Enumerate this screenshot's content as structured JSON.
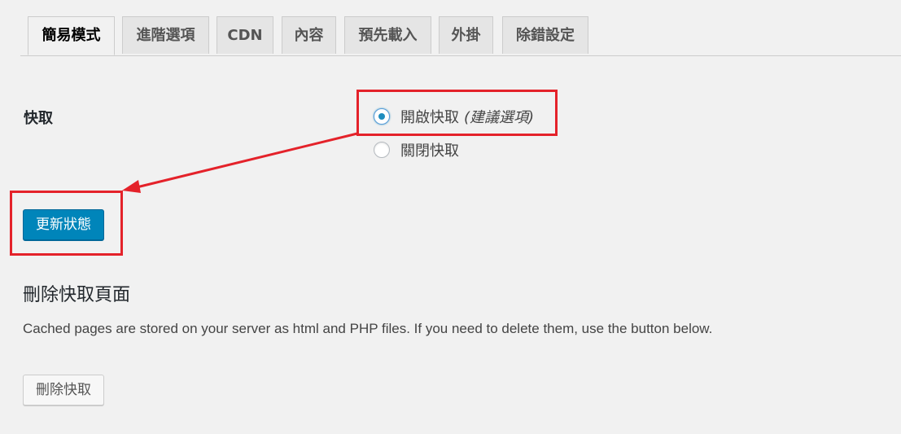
{
  "tabs": [
    {
      "label": "簡易模式",
      "active": true
    },
    {
      "label": "進階選項",
      "active": false
    },
    {
      "label": "CDN",
      "active": false
    },
    {
      "label": "內容",
      "active": false
    },
    {
      "label": "預先載入",
      "active": false
    },
    {
      "label": "外掛",
      "active": false
    },
    {
      "label": "除錯設定",
      "active": false
    }
  ],
  "caching": {
    "label": "快取",
    "options": [
      {
        "label": "開啟快取",
        "hint": "(建議選項)",
        "checked": true
      },
      {
        "label": "關閉快取",
        "hint": "",
        "checked": false
      }
    ]
  },
  "update_button": {
    "label": "更新狀態"
  },
  "delete_section": {
    "title": "刪除快取頁面",
    "description": "Cached pages are stored on your server as html and PHP files. If you need to delete them, use the button below.",
    "button_label": "刪除快取"
  },
  "colors": {
    "annotation": "#e4222a",
    "primary_button": "#0085ba",
    "background": "#f1f1f1"
  }
}
